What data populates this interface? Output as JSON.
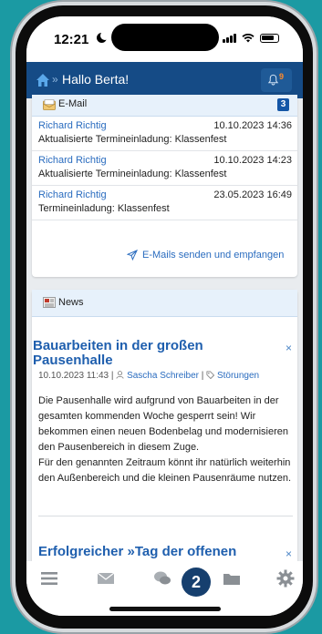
{
  "status": {
    "time": "12:21"
  },
  "header": {
    "greeting": "Hallo Berta!",
    "separator": "»",
    "notification_count": "9"
  },
  "email": {
    "title": "E-Mail",
    "count": "3",
    "messages": [
      {
        "sender": "Richard Richtig",
        "date": "10.10.2023 14:36",
        "subject": "Aktualisierte Termineinladung: Klassenfest"
      },
      {
        "sender": "Richard Richtig",
        "date": "10.10.2023 14:23",
        "subject": "Aktualisierte Termineinladung: Klassenfest"
      },
      {
        "sender": "Richard Richtig",
        "date": "23.05.2023 16:49",
        "subject": "Termineinladung: Klassenfest"
      }
    ],
    "action_label": "E-Mails senden und empfangen"
  },
  "news": {
    "title": "News",
    "articles": [
      {
        "title": "Bauarbeiten in der großen Pausenhalle",
        "date": "10.10.2023 11:43",
        "author": "Sascha Schreiber",
        "category": "Störungen",
        "paragraphs": [
          "Die Pausenhalle wird aufgrund von Bauarbeiten in der gesamten kommenden Woche gesperrt sein! Wir bekommen einen neuen Bodenbelag und modernisieren den Pausenbereich in diesem Zuge.",
          "Für den genannten Zeitraum könnt ihr natürlich weiterhin den Außenbereich und die kleinen Pausenräume nutzen."
        ]
      },
      {
        "title": "Erfolgreicher »Tag der offenen Tür«"
      }
    ],
    "close_symbol": "×"
  },
  "bottom_nav": {
    "items": [
      "menu-icon",
      "mail-icon",
      "chat-icon",
      "folder-icon",
      "settings-icon"
    ],
    "marker_number": "2"
  },
  "colors": {
    "accent": "#154b86",
    "link": "#2a6cbf",
    "background": "#1b9aa3"
  }
}
